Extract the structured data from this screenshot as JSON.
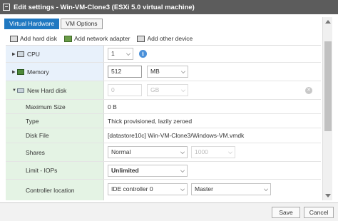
{
  "window": {
    "title": "Edit settings - Win-VM-Clone3 (ESXi 5.0 virtual machine)"
  },
  "tabs": [
    {
      "label": "Virtual Hardware",
      "active": true
    },
    {
      "label": "VM Options",
      "active": false
    }
  ],
  "toolbar": {
    "add_hard_disk": "Add hard disk",
    "add_network_adapter": "Add network adapter",
    "add_other_device": "Add other device"
  },
  "rows": {
    "cpu": {
      "label": "CPU",
      "value": "1"
    },
    "memory": {
      "label": "Memory",
      "value": "512",
      "unit": "MB"
    },
    "new_hard_disk": {
      "label": "New Hard disk",
      "value": "0",
      "unit": "GB"
    },
    "maximum_size": {
      "label": "Maximum Size",
      "value": "0 B"
    },
    "type": {
      "label": "Type",
      "value": "Thick provisioned, lazily zeroed"
    },
    "disk_file": {
      "label": "Disk File",
      "value": "[datastore10c] Win-VM-Clone3/Windows-VM.vmdk"
    },
    "shares": {
      "label": "Shares",
      "value": "Normal",
      "amount": "1000"
    },
    "limit_iops": {
      "label": "Limit - IOPs",
      "value": "Unlimited"
    },
    "controller_location": {
      "label": "Controller location",
      "controller": "IDE controller 0",
      "position": "Master"
    }
  },
  "footer": {
    "save_label": "Save",
    "cancel_label": "Cancel"
  },
  "colors": {
    "accent": "#1f78c1",
    "titlebar": "#5c5c5c",
    "hw_label_bg": "#e8f1fb",
    "disk_label_bg": "#e4f3e4"
  }
}
